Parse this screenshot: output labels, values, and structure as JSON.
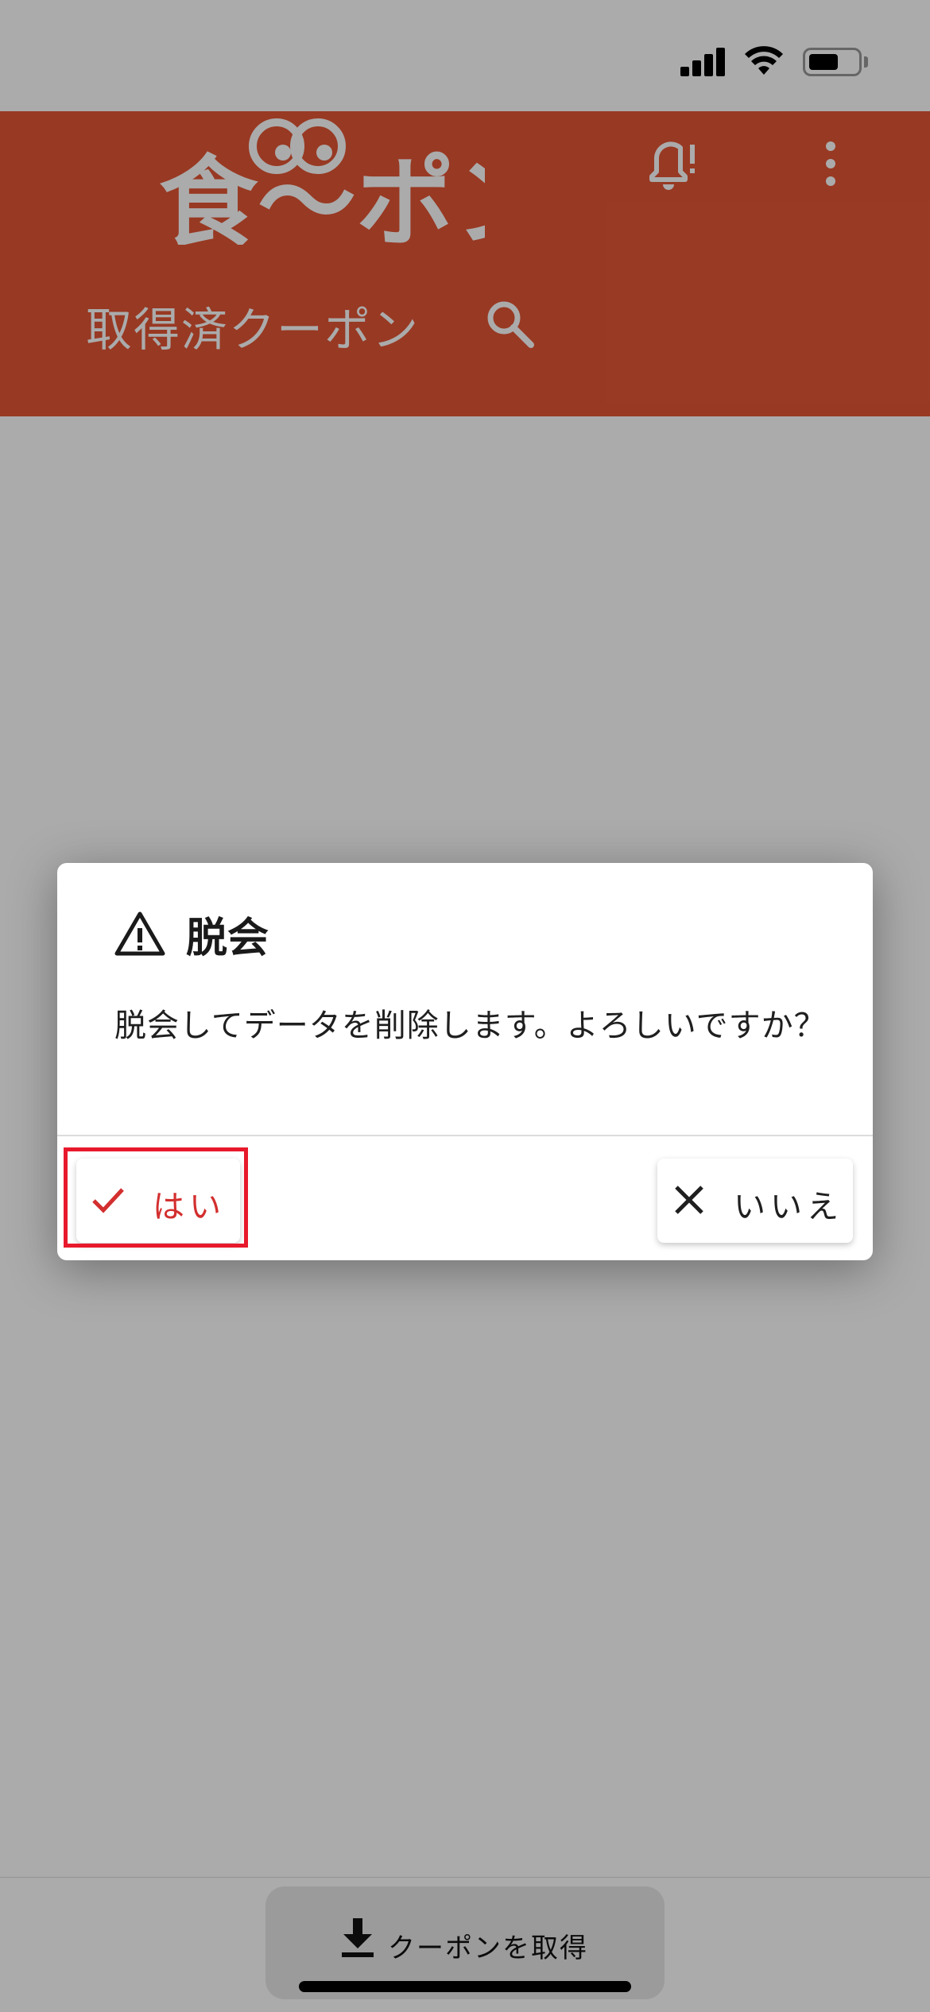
{
  "status_bar": {
    "icons": [
      "signal-icon",
      "wifi-icon",
      "battery-icon"
    ]
  },
  "app_bar": {
    "logo_text": "食〜ポン",
    "title": "取得済クーポン",
    "icons": [
      "bell-alert-icon",
      "more-vert-icon",
      "search-icon"
    ],
    "color": "#e35635"
  },
  "dialog": {
    "title": "脱会",
    "title_icon": "warning-icon",
    "message": "脱会してデータを削除します。よろしいですか？",
    "yes_label": "はい",
    "yes_icon": "check-icon",
    "no_label": "いいえ",
    "no_icon": "close-icon",
    "yes_color": "#d32f2f",
    "highlight_color": "#e8192c"
  },
  "bottom": {
    "get_coupon_label": "クーポンを取得",
    "get_coupon_icon": "download-icon"
  }
}
